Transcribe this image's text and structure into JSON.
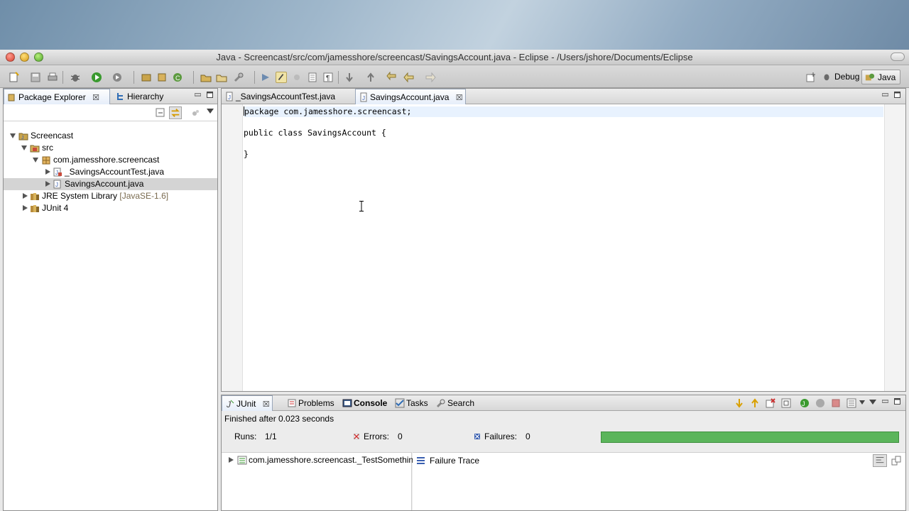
{
  "window": {
    "title": "Java - Screencast/src/com/jamesshore/screencast/SavingsAccount.java - Eclipse - /Users/jshore/Documents/Eclipse"
  },
  "perspectives": {
    "debug_label": "Debug",
    "java_label": "Java"
  },
  "left_panel": {
    "tabs": [
      {
        "label": "Package Explorer"
      },
      {
        "label": "Hierarchy"
      }
    ],
    "tree": [
      {
        "label": "Screencast",
        "icon": "project-icon"
      },
      {
        "label": "src",
        "icon": "source-folder-icon"
      },
      {
        "label": "com.jamesshore.screencast",
        "icon": "package-icon"
      },
      {
        "label": "_SavingsAccountTest.java",
        "icon": "java-file-icon"
      },
      {
        "label": "SavingsAccount.java",
        "icon": "java-file-icon"
      },
      {
        "label": "JRE System Library",
        "suffix": "[JavaSE-1.6]",
        "icon": "library-icon"
      },
      {
        "label": "JUnit 4",
        "icon": "library-icon"
      }
    ]
  },
  "editor": {
    "tabs": [
      {
        "label": "_SavingsAccountTest.java"
      },
      {
        "label": "SavingsAccount.java"
      }
    ],
    "code_lines": [
      "ackage com.jamesshore.screencast;",
      "",
      "public class SavingsAccount {",
      "",
      "}"
    ],
    "first_char": "p"
  },
  "bottom_panel": {
    "tabs": [
      {
        "label": "JUnit"
      },
      {
        "label": "Problems"
      },
      {
        "label": "Console"
      },
      {
        "label": "Tasks"
      },
      {
        "label": "Search"
      }
    ],
    "status": "Finished after 0.023 seconds",
    "runs_label": "Runs:",
    "runs_value": "1/1",
    "errors_label": "Errors:",
    "errors_value": "0",
    "failures_label": "Failures:",
    "failures_value": "0",
    "progress": 1.0,
    "progress_color": "#5bb55b",
    "test_item": "com.jamesshore.screencast._TestSomethin",
    "failure_trace_label": "Failure Trace"
  }
}
